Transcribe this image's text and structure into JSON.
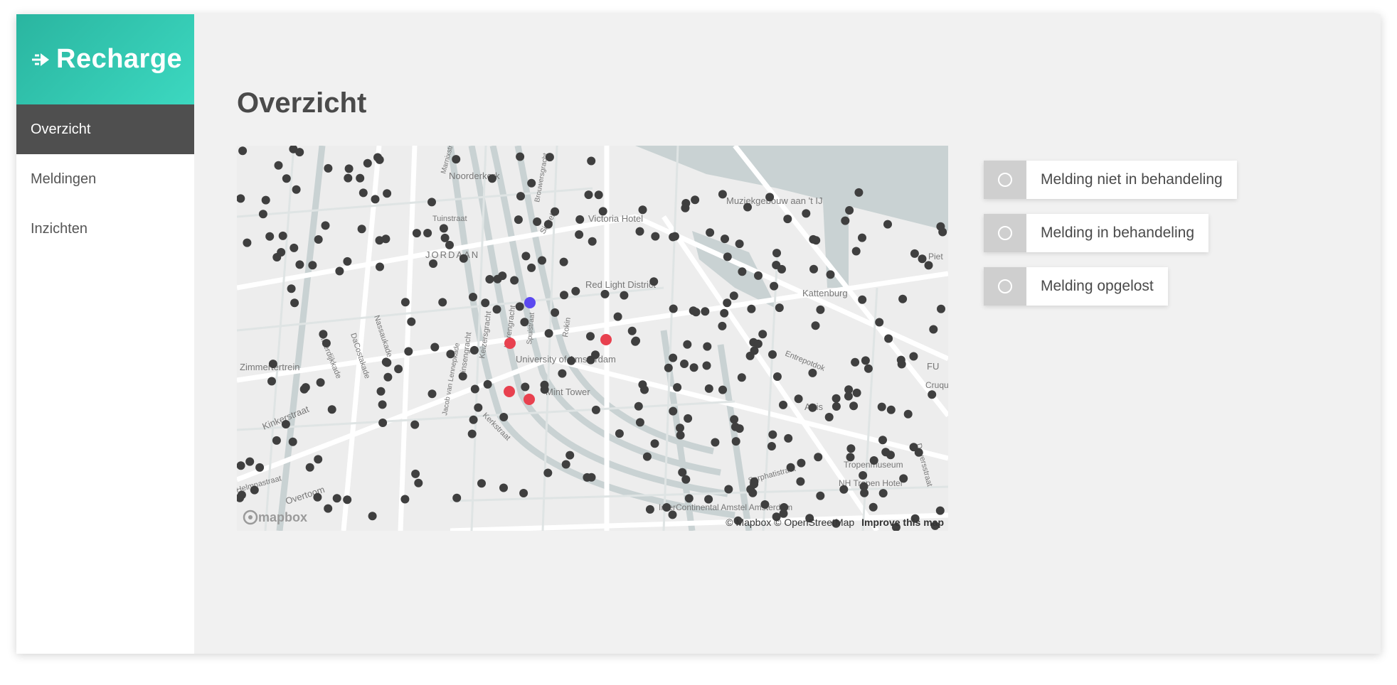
{
  "brand": {
    "name": "Recharge",
    "color": "#34c9b1",
    "icon": "plug-icon"
  },
  "nav": {
    "items": [
      {
        "label": "Overzicht",
        "active": true
      },
      {
        "label": "Meldingen",
        "active": false
      },
      {
        "label": "Inzichten",
        "active": false
      }
    ]
  },
  "main": {
    "title": "Overzicht"
  },
  "map": {
    "place_labels": [
      "Noorderkerk",
      "Victoria Hotel",
      "Muziekgebouw aan 't IJ",
      "Tuinstraat",
      "JORDAAN",
      "Red Light District",
      "Kattenburg",
      "University of Amsterdam",
      "Mint Tower",
      "Zimmertertrein",
      "Kinkerstraat",
      "Overtoom",
      "Kerkstraat",
      "Artis",
      "Tropenmuseum",
      "NH Tropen Hotel",
      "Sarphatistraat",
      "InterContinental Amstel Amsterdam",
      "Entrepotdok",
      "Bilderdijkkade",
      "Prinsengracht",
      "Keizersgracht",
      "Herengracht",
      "Rokin",
      "Singel",
      "Piet",
      "Cruqu",
      "FU",
      "Daversstraat",
      "Helmnastraat",
      "DaCostakade",
      "Nassaukade",
      "Marnixstraat",
      "Spuistraat",
      "Brouwersgracht",
      "Jacob van Lennepkade"
    ],
    "attribution": "© Mapbox © OpenStreetMap",
    "improve_link": "Improve this map",
    "logo_text": "mapbox",
    "marker_colors": {
      "default": "#3f3f3f",
      "not_handled": "#e8414f",
      "in_progress": "#5b49f0"
    }
  },
  "legend": {
    "items": [
      {
        "label": "Melding niet in behandeling"
      },
      {
        "label": "Melding in behandeling"
      },
      {
        "label": "Melding opgelost"
      }
    ]
  }
}
